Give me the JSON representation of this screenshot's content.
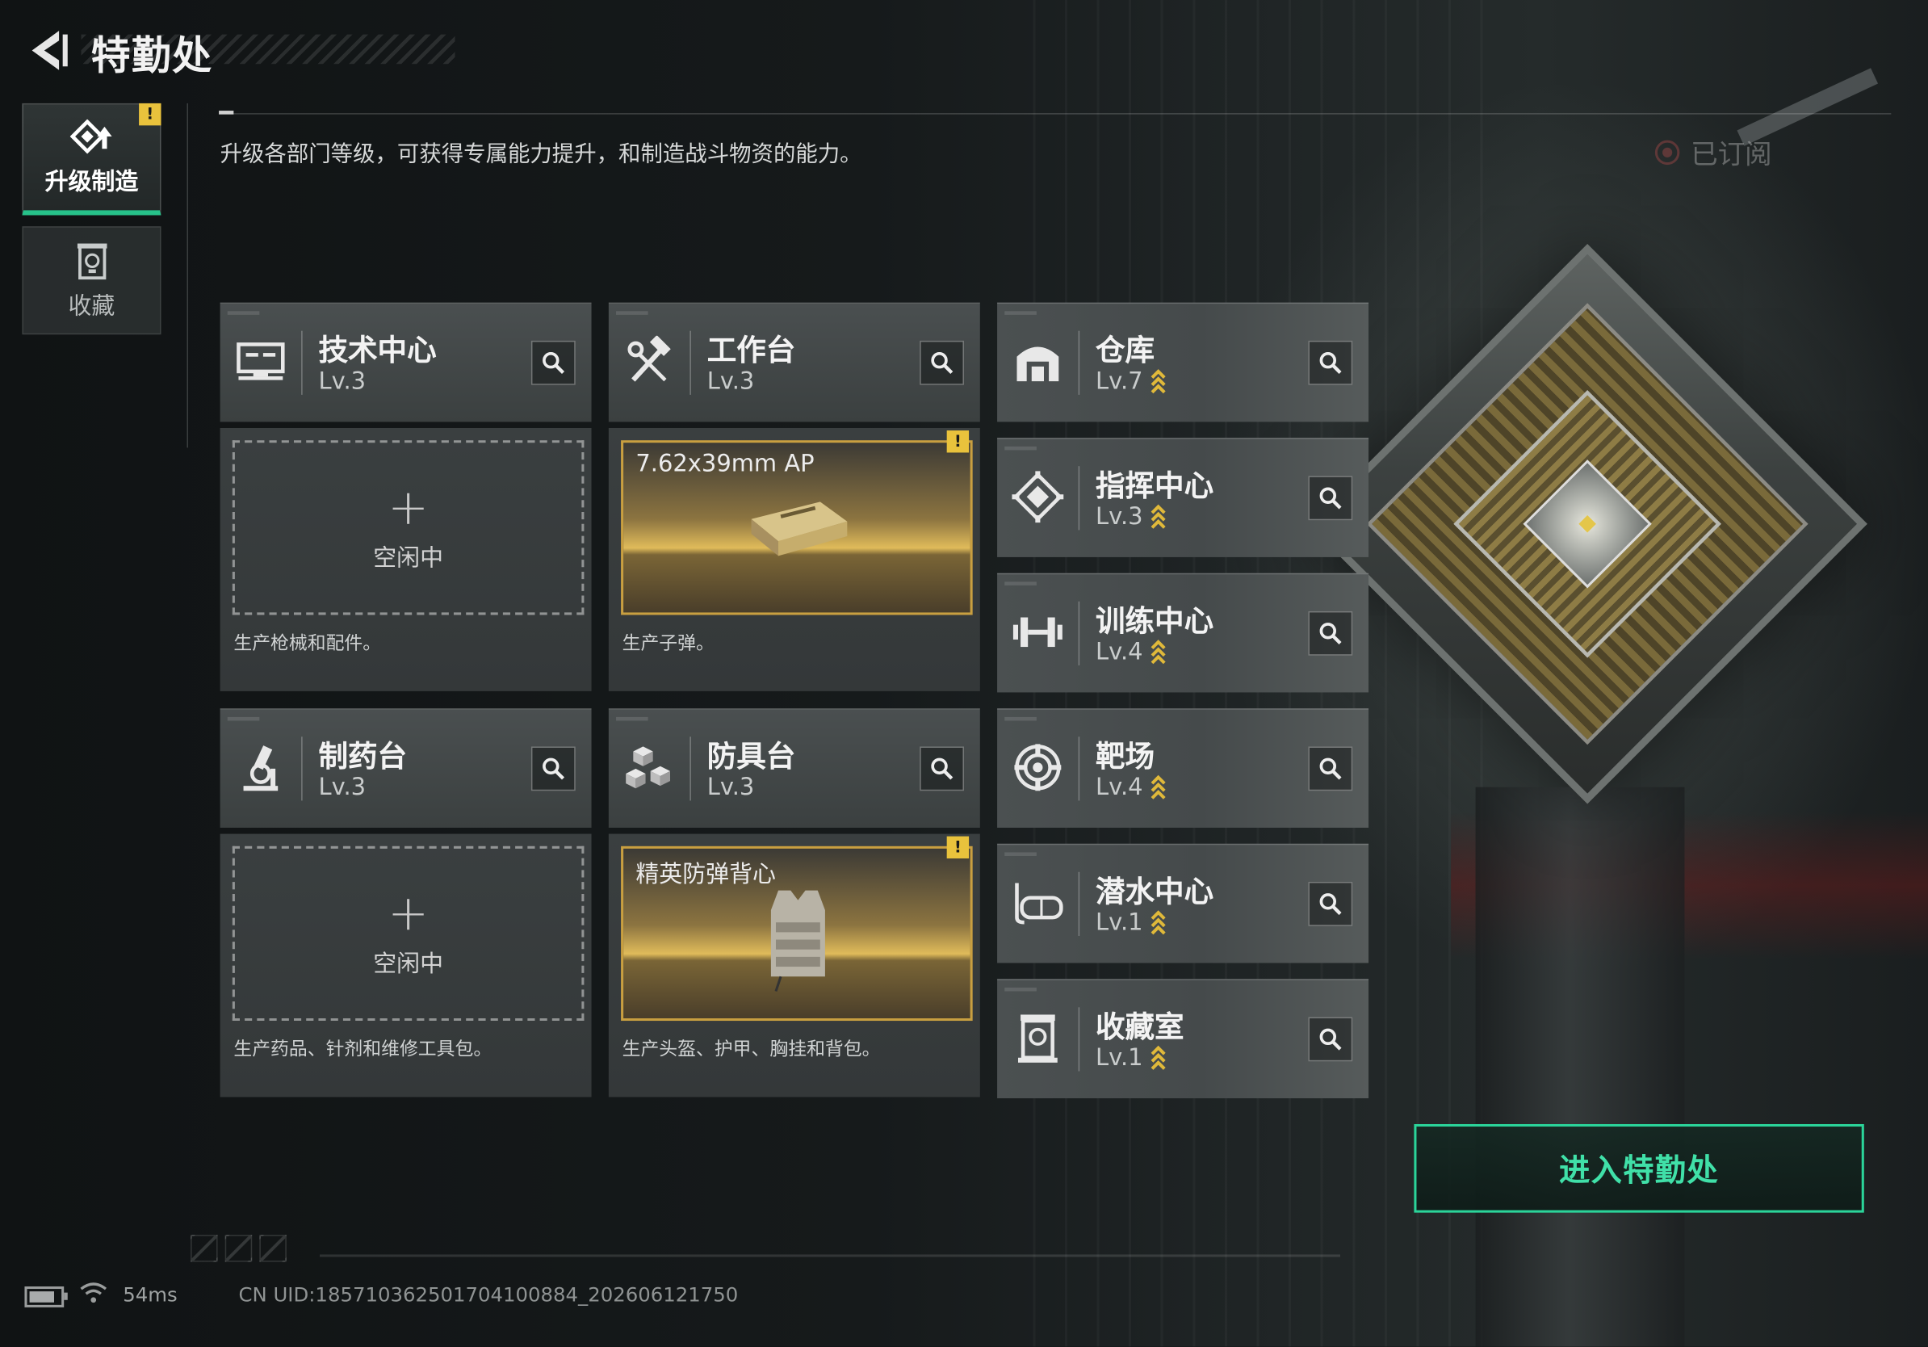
{
  "header": {
    "title": "特勤处",
    "description": "升级各部门等级，可获得专属能力提升，和制造战斗物资的能力。",
    "subscribed_label": "已订阅"
  },
  "sidebar": {
    "items": [
      {
        "label": "升级制造",
        "icon": "upgrade-icon",
        "active": true,
        "alert": "!"
      },
      {
        "label": "收藏",
        "icon": "collection-icon",
        "active": false
      }
    ]
  },
  "departments": {
    "tech_center": {
      "name": "技术中心",
      "level": "Lv.3",
      "icon": "monitor-icon",
      "status": "空闲中",
      "plus": "+",
      "desc": "生产枪械和配件。"
    },
    "workbench": {
      "name": "工作台",
      "level": "Lv.3",
      "icon": "hammer-wrench-icon",
      "product": "7.62x39mm AP",
      "product_icon": "ammo-box-icon",
      "alert": "!",
      "desc": "生产子弹。"
    },
    "pharmacy": {
      "name": "制药台",
      "level": "Lv.3",
      "icon": "microscope-icon",
      "status": "空闲中",
      "plus": "+",
      "desc": "生产药品、针剂和维修工具包。"
    },
    "armor_bench": {
      "name": "防具台",
      "level": "Lv.3",
      "icon": "blocks-icon",
      "product": "精英防弹背心",
      "product_icon": "vest-icon",
      "alert": "!",
      "desc": "生产头盔、护甲、胸挂和背包。"
    },
    "warehouse": {
      "name": "仓库",
      "level": "Lv.7",
      "icon": "warehouse-icon",
      "upgradable": true
    },
    "command_center": {
      "name": "指挥中心",
      "level": "Lv.3",
      "icon": "command-icon",
      "upgradable": true
    },
    "training_center": {
      "name": "训练中心",
      "level": "Lv.4",
      "icon": "dumbbell-icon",
      "upgradable": true
    },
    "shooting_range": {
      "name": "靶场",
      "level": "Lv.4",
      "icon": "target-icon",
      "upgradable": true
    },
    "diving_center": {
      "name": "潜水中心",
      "level": "Lv.1",
      "icon": "diving-mask-icon",
      "upgradable": true
    },
    "collection_room": {
      "name": "收藏室",
      "level": "Lv.1",
      "icon": "display-case-icon",
      "upgradable": true
    }
  },
  "actions": {
    "enter_label": "进入特勤处"
  },
  "status_bar": {
    "ping": "54ms",
    "uid": "CN UID:18571036250170410088​4_202606121750"
  },
  "colors": {
    "accent_green": "#2bd49a",
    "upgrade_gold": "#e0b93a",
    "alert_yellow": "#e9c23c"
  }
}
